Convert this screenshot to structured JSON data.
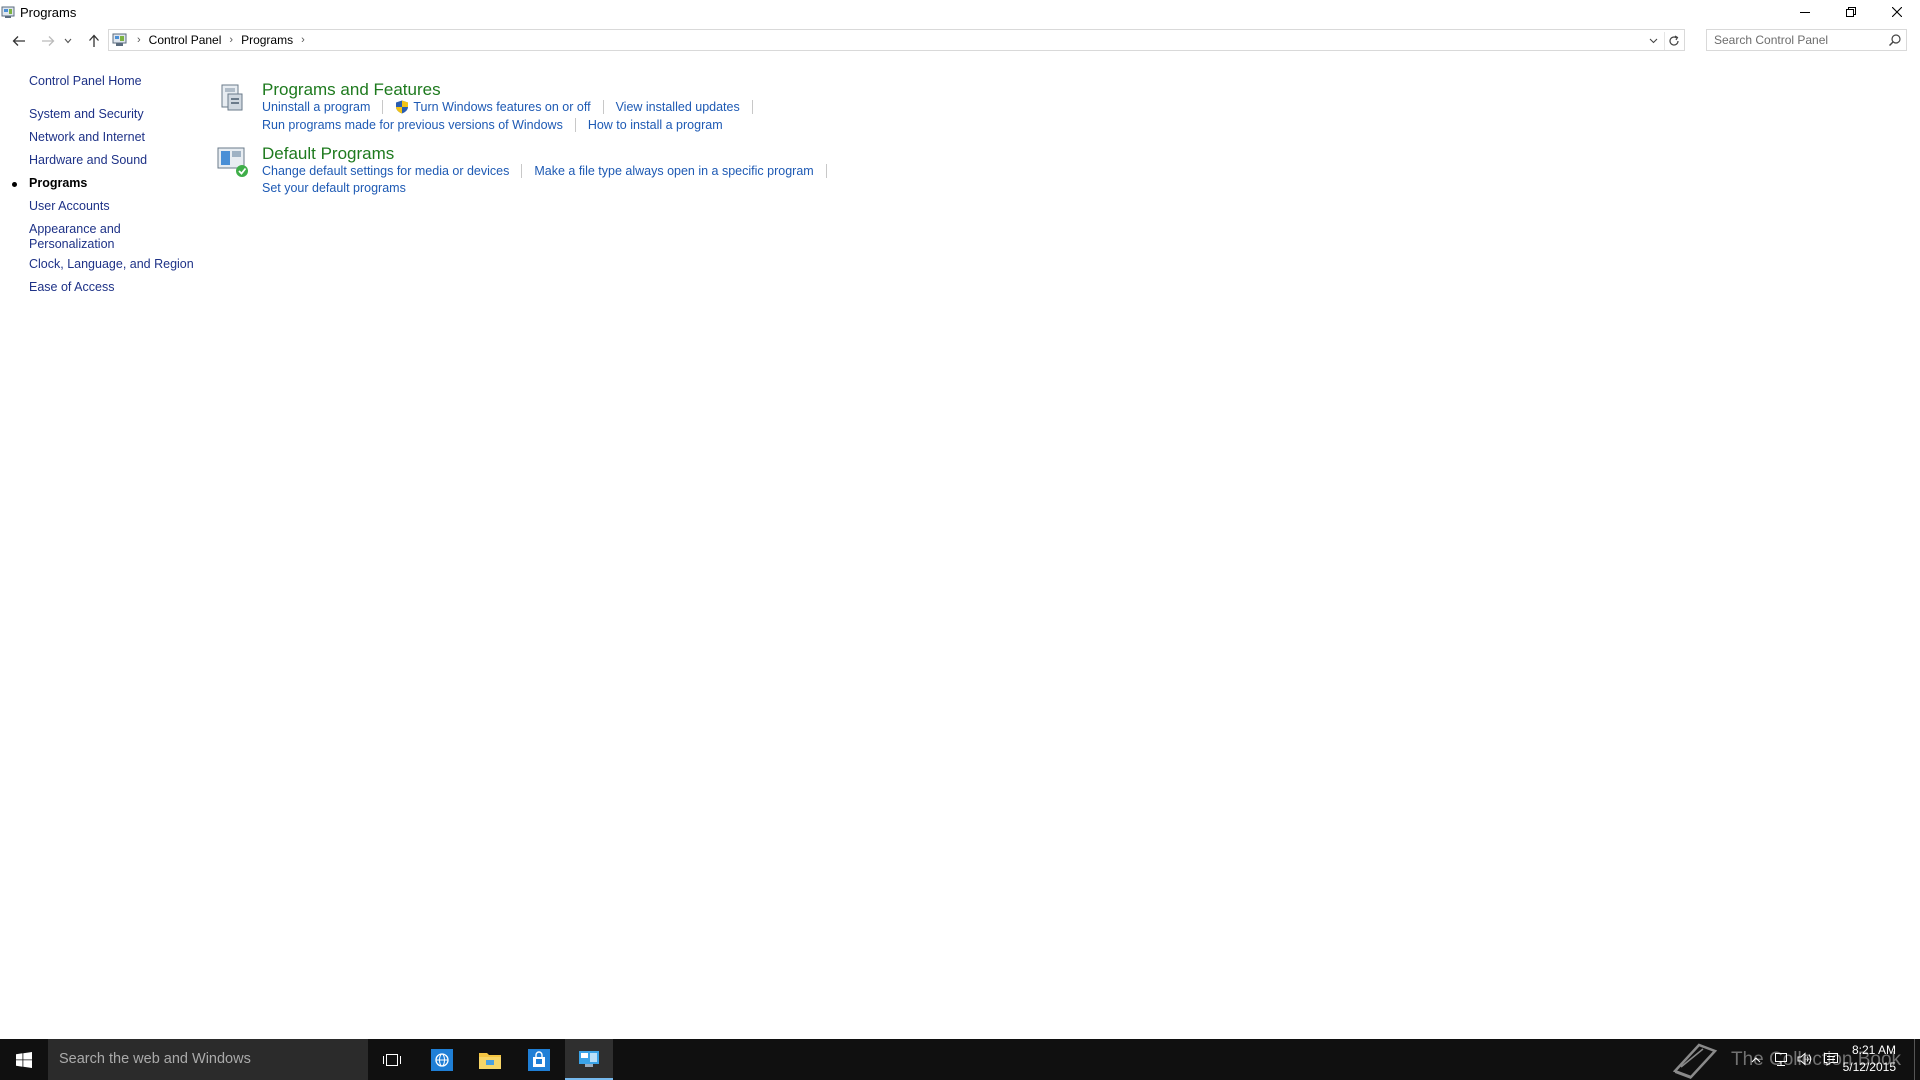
{
  "window": {
    "title": "Programs"
  },
  "address_bar": {
    "crumbs": [
      "Control Panel",
      "Programs"
    ]
  },
  "search": {
    "placeholder": "Search Control Panel"
  },
  "sidebar": {
    "items": [
      {
        "label": "Control Panel Home"
      },
      {
        "label": "System and Security"
      },
      {
        "label": "Network and Internet"
      },
      {
        "label": "Hardware and Sound"
      },
      {
        "label": "Programs",
        "current": true
      },
      {
        "label": "User Accounts"
      },
      {
        "label": "Appearance and"
      },
      {
        "label": "Personalization"
      },
      {
        "label": "Clock, Language, and Region"
      },
      {
        "label": "Ease of Access"
      }
    ]
  },
  "main": {
    "categories": [
      {
        "title": "Programs and Features",
        "icon": "programs-features-icon",
        "rows": [
          [
            "Uninstall a program",
            "Turn Windows features on or off",
            "View installed updates"
          ],
          [
            "Run programs made for previous versions of Windows",
            "How to install a program"
          ]
        ]
      },
      {
        "title": "Default Programs",
        "icon": "default-programs-icon",
        "rows": [
          [
            "Change default settings for media or devices",
            "Make a file type always open in a specific program"
          ],
          [
            "Set your default programs"
          ]
        ]
      }
    ]
  },
  "taskbar": {
    "search_placeholder": "Search the web and Windows",
    "watermark": "The Collection Book",
    "time": "8:21 AM",
    "date": "5/12/2015"
  },
  "colors": {
    "link": "#1e5ab4",
    "nav_link": "#1e3287",
    "category_title": "#1e7a1e",
    "taskbar": "#101010",
    "taskbar_search": "#2b2b2b"
  }
}
